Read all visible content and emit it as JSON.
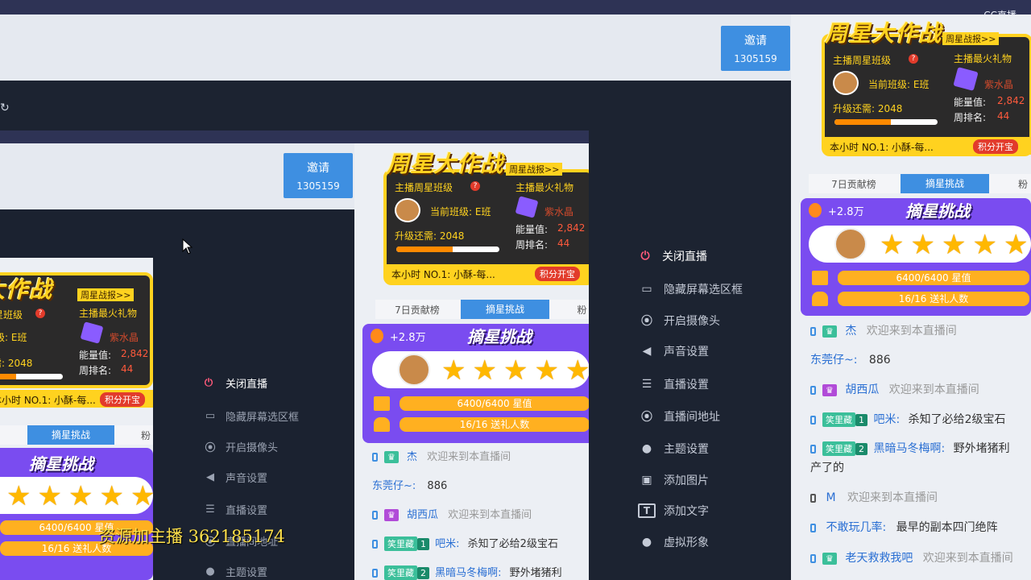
{
  "watermark": "CC直播",
  "invite": {
    "label": "邀请",
    "code": "1305159"
  },
  "board": {
    "title": "周星大作战",
    "report": "周星战报>>",
    "anchor_class_label": "主播周星班级",
    "gift_label": "主播最火礼物",
    "current_class": "当前班级: E班",
    "gift_name": "紫水晶",
    "upgrade": "升级还需: 2048",
    "energy_label": "能量值:",
    "energy_value": "2,842",
    "week_rank_label": "周排名:",
    "week_rank_value": "44",
    "hour_top": "本小时 NO.1: 小酥-每...",
    "fold_btn": "积分开宝",
    "upgrade_progress": 0.55
  },
  "tabs": [
    "7日贡献榜",
    "摘星挑战",
    "粉"
  ],
  "challenge": {
    "coin": "+2.8万",
    "title": "摘星挑战",
    "stars": 5,
    "star_progress": "6400/6400 星值",
    "gift_progress": "16/16 送礼人数"
  },
  "menu": [
    {
      "label": "关闭直播",
      "icon": "power-icon"
    },
    {
      "label": "隐藏屏幕选区框",
      "icon": "monitor-icon"
    },
    {
      "label": "开启摄像头",
      "icon": "camera-icon"
    },
    {
      "label": "声音设置",
      "icon": "speaker-icon"
    },
    {
      "label": "直播设置",
      "icon": "sliders-icon"
    },
    {
      "label": "直播间地址",
      "icon": "location-icon"
    },
    {
      "label": "主题设置",
      "icon": "palette-icon"
    },
    {
      "label": "添加图片",
      "icon": "image-icon"
    },
    {
      "label": "添加文字",
      "icon": "text-icon"
    },
    {
      "label": "虚拟形象",
      "icon": "avatar-icon"
    }
  ],
  "chat": [
    {
      "user": "杰",
      "msg": "欢迎来到本直播间"
    },
    {
      "user": "东莞仔~:",
      "msg": "886"
    },
    {
      "user": "胡西瓜",
      "msg": "欢迎来到本直播间"
    },
    {
      "badge": "笑里藏",
      "level": "1",
      "user": "吧米:",
      "msg": "杀知了必给2级宝石"
    },
    {
      "badge": "笑里藏",
      "level": "2",
      "user": "黑暗马冬梅啊:",
      "msg": "野外堵猪利",
      "msg2": "产了的"
    },
    {
      "user": "M",
      "msg": "欢迎来到本直播间"
    },
    {
      "user": "不敢玩几率:",
      "msg": "最早的副本四门绝阵"
    },
    {
      "user": "老天救救我吧",
      "msg": "欢迎来到本直播间"
    }
  ],
  "overlay_text": "资源加主播 362185174"
}
